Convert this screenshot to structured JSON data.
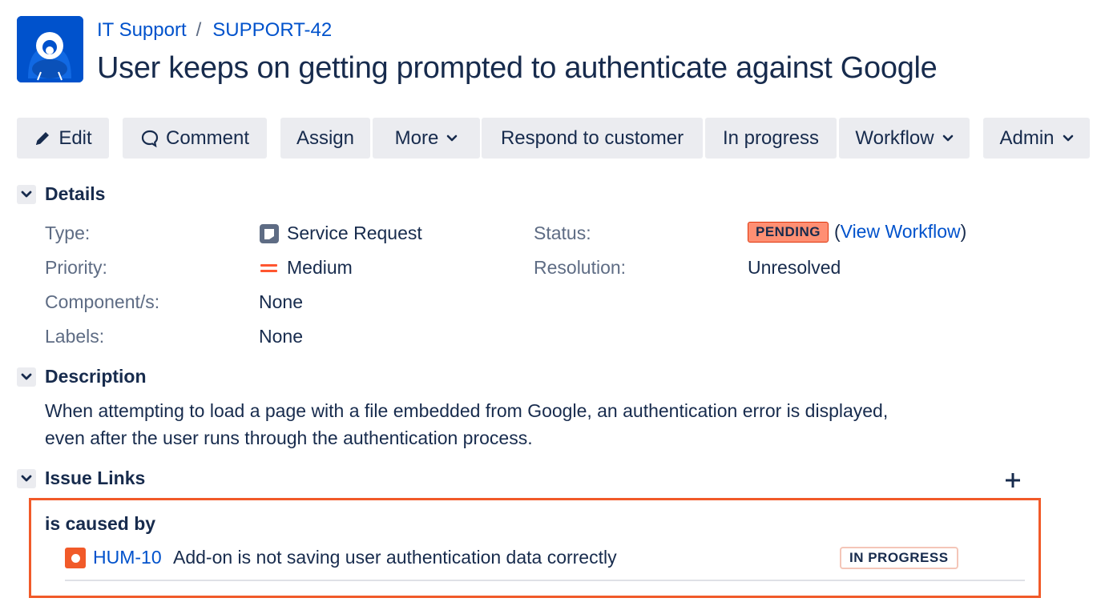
{
  "breadcrumbs": {
    "project": "IT Support",
    "separator": "/",
    "issue_key": "SUPPORT-42"
  },
  "issue": {
    "title": "User keeps on getting prompted to authenticate against Google"
  },
  "toolbar": {
    "edit": "Edit",
    "comment": "Comment",
    "assign": "Assign",
    "more": "More",
    "respond": "Respond to customer",
    "in_progress": "In progress",
    "workflow": "Workflow",
    "admin": "Admin"
  },
  "details": {
    "heading": "Details",
    "type_label": "Type:",
    "type_value": "Service Request",
    "priority_label": "Priority:",
    "priority_value": "Medium",
    "components_label": "Component/s:",
    "components_value": "None",
    "labels_label": "Labels:",
    "labels_value": "None",
    "status_label": "Status:",
    "status_value": "PENDING",
    "view_workflow_open": "(",
    "view_workflow": "View Workflow",
    "view_workflow_close": ")",
    "resolution_label": "Resolution:",
    "resolution_value": "Unresolved"
  },
  "description": {
    "heading": "Description",
    "line1": "When attempting to load a page with a file embedded from Google, an authentication error is displayed,",
    "line2": "even after the user runs through the authentication process."
  },
  "issue_links": {
    "heading": "Issue Links",
    "link_type": "is caused by",
    "items": [
      {
        "key": "HUM-10",
        "summary": "Add-on is not saving user authentication data correctly",
        "status": "IN PROGRESS"
      }
    ]
  },
  "icons": {
    "avatar": "project-avatar-icon",
    "edit": "pencil-icon",
    "comment": "comment-icon",
    "chevron": "chevron-down-icon",
    "toggle": "chevron-down-icon",
    "add": "plus-icon",
    "type": "service-request-icon",
    "priority": "priority-medium-icon",
    "issue": "issue-type-icon"
  },
  "colors": {
    "brand": "#0052cc",
    "pending": "#ff8f73",
    "priority_medium": "#ff5630",
    "highlight_border": "#f15a29",
    "button_bg": "#ebecf0"
  }
}
